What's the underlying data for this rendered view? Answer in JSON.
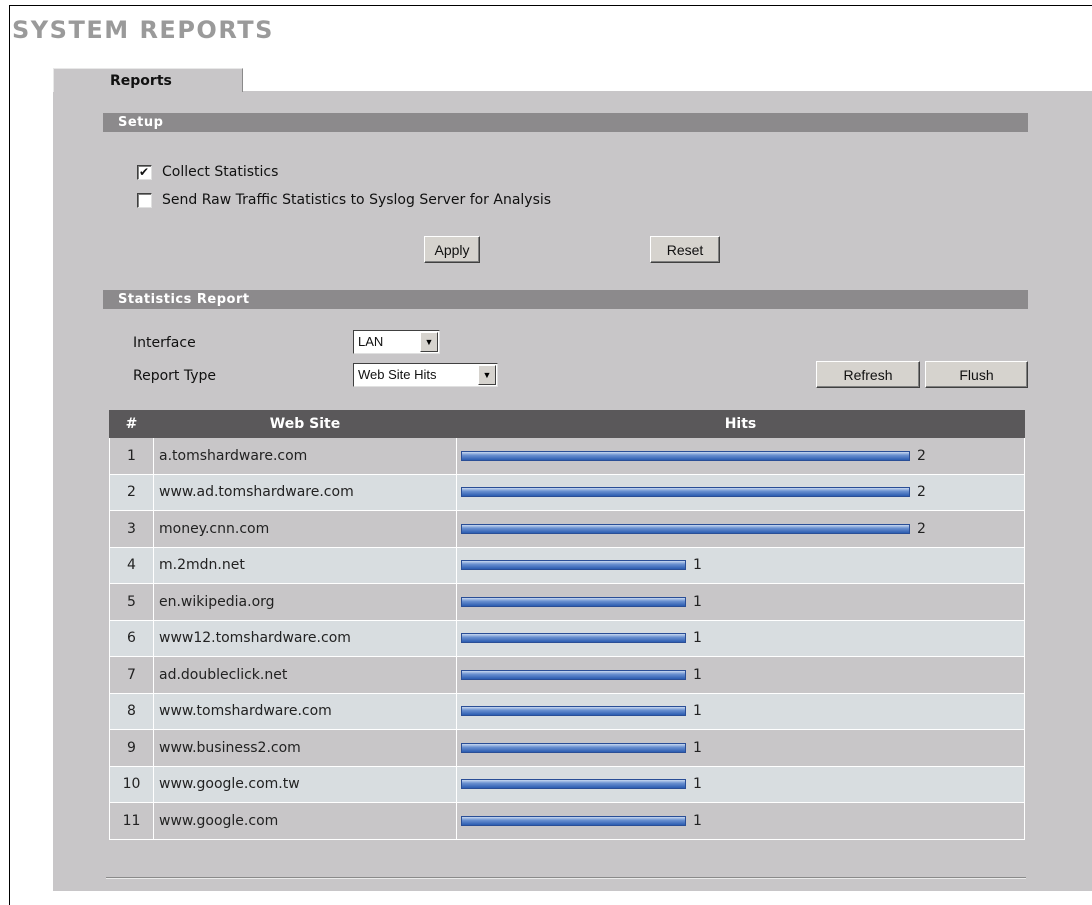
{
  "page": {
    "title": "SYSTEM REPORTS"
  },
  "tabs": [
    {
      "label": "Reports"
    }
  ],
  "setup": {
    "heading": "Setup",
    "collect_statistics": {
      "label": "Collect Statistics",
      "checked": true
    },
    "send_raw": {
      "label": "Send Raw Traffic Statistics to Syslog Server for Analysis",
      "checked": false
    },
    "apply_label": "Apply",
    "reset_label": "Reset"
  },
  "report": {
    "heading": "Statistics Report",
    "interface_label": "Interface",
    "interface_value": "LAN",
    "report_type_label": "Report Type",
    "report_type_value": "Web Site Hits",
    "refresh_label": "Refresh",
    "flush_label": "Flush",
    "columns": [
      "#",
      "Web Site",
      "Hits"
    ],
    "max_hits": 2,
    "rows": [
      {
        "num": "1",
        "site": "a.tomshardware.com",
        "hits": 2
      },
      {
        "num": "2",
        "site": "www.ad.tomshardware.com",
        "hits": 2
      },
      {
        "num": "3",
        "site": "money.cnn.com",
        "hits": 2
      },
      {
        "num": "4",
        "site": "m.2mdn.net",
        "hits": 1
      },
      {
        "num": "5",
        "site": "en.wikipedia.org",
        "hits": 1
      },
      {
        "num": "6",
        "site": "www12.tomshardware.com",
        "hits": 1
      },
      {
        "num": "7",
        "site": "ad.doubleclick.net",
        "hits": 1
      },
      {
        "num": "8",
        "site": "www.tomshardware.com",
        "hits": 1
      },
      {
        "num": "9",
        "site": "www.business2.com",
        "hits": 1
      },
      {
        "num": "10",
        "site": "www.google.com.tw",
        "hits": 1
      },
      {
        "num": "11",
        "site": "www.google.com",
        "hits": 1
      }
    ]
  }
}
